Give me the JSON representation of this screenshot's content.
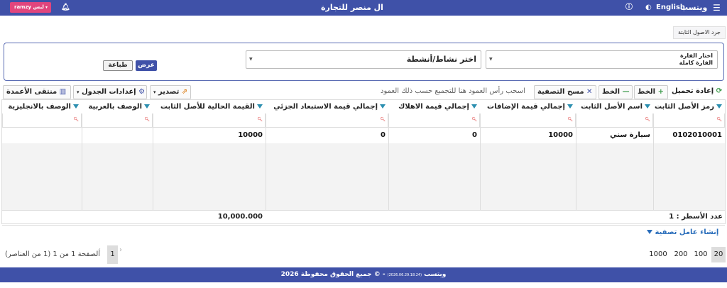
{
  "topbar": {
    "menu_icon": "hamburger-icon",
    "app_name": "ويتسب",
    "language": "English",
    "palette_icon": "palette-icon",
    "help_icon": "help-icon",
    "company": "ال منصر للتجارة",
    "bell_icon": "bell-icon",
    "user": "ramzy لبس",
    "user_caret": "▾"
  },
  "tabs": [
    "جرد الاصول الثابتة"
  ],
  "filters": {
    "branch_label": "اختار الفارة",
    "branch_value": "الفارة كاملة",
    "activity_value": "اختر نشاط/أنشطة",
    "view_label": "عرض",
    "print_label": "طباعة"
  },
  "toolbar": {
    "reload": "إعادة تحميل",
    "add_line": "الخط",
    "remove_line": "الخط",
    "clear_filter": "مسح التصفية",
    "group_hint": "اسحب رأس العمود هنا للتجميع حسب ذلك العمود",
    "export": "تصدير",
    "table_settings": "إعدادات الجدول",
    "column_picker": "منتقى الأعمدة"
  },
  "table": {
    "columns": [
      "رمز الأصل الثابت",
      "اسم الأصل الثابت",
      "إجمالي قيمة الإضافات",
      "إجمالي قيمة الاهلاك",
      "إجمالي قيمة الاستبعاد الجزئي",
      "القيمة الحالية للأصل الثابت",
      "الوصف بالعربية",
      "الوصف بالانجليزية"
    ],
    "rows": [
      [
        "0102010001",
        "سيارة سني",
        "10000",
        "0",
        "0",
        "10000",
        "",
        ""
      ]
    ],
    "row_count_label": "عدد الأسطر : 1",
    "total_current_value": "10,000.000"
  },
  "create_filter": "إنشاء عامل تصفية",
  "pager": {
    "page_sizes": [
      "20",
      "100",
      "200",
      "1000"
    ],
    "active_size": "20",
    "current_page": "1",
    "summary": "الصفحة 1 من 1 (1 من العناصر)"
  },
  "footer": {
    "app_name": "ويتسب",
    "version": "(2026.06.29.18.24)",
    "copyright": "- © جميع الحقوق محفوظة 2026"
  },
  "colors": {
    "primary": "#3f51a8",
    "accent_pink": "#e1457d",
    "filter_icon": "#2b8fb0"
  }
}
